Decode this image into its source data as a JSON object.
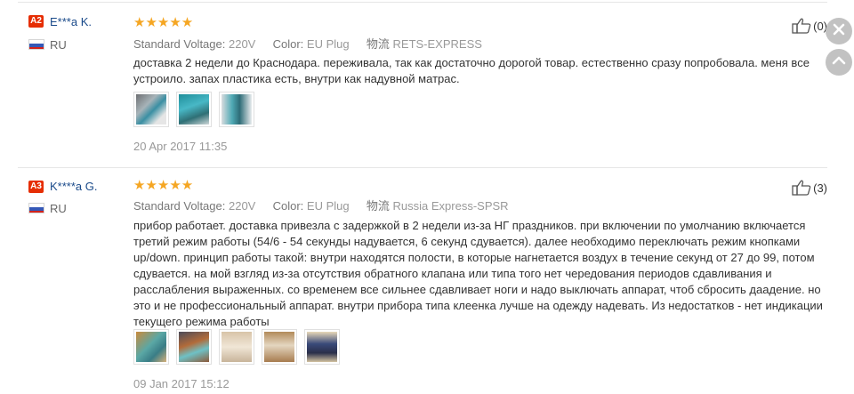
{
  "reviews": [
    {
      "level_badge": "A2",
      "user": "E***a K.",
      "country": "RU",
      "rating_stars": 5,
      "stars_text": "★★★★★",
      "meta": {
        "voltage_label": "Standard Voltage:",
        "voltage_value": "220V",
        "color_label": "Color:",
        "color_value": "EU Plug",
        "ship_label": "物流",
        "ship_value": "RETS-EXPRESS"
      },
      "text": "доставка 2 недели до Краснодара. переживала, так как достаточно дорогой товар. естественно сразу попробовала. меня все устроило. запах пластика есть, внутри как надувной матрас.",
      "date": "20 Apr 2017 11:35",
      "helpful_count": "(0)",
      "photo_count": 3
    },
    {
      "level_badge": "A3",
      "user": "K****a G.",
      "country": "RU",
      "rating_stars": 5,
      "stars_text": "★★★★★",
      "meta": {
        "voltage_label": "Standard Voltage:",
        "voltage_value": "220V",
        "color_label": "Color:",
        "color_value": "EU Plug",
        "ship_label": "物流",
        "ship_value": "Russia Express-SPSR"
      },
      "text": "прибор работает. доставка привезла с задержкой в 2 недели из-за НГ праздников. при включении по умолчанию включается третий режим работы (54/6 - 54 секунды надувается, 6 секунд сдувается). далее необходимо переключать режим кнопками up/down. принцип работы такой: внутри находятся полости, в которые нагнетается воздух в течение секунд от 27 до 99, потом сдувается. на мой взгляд из-за отсутствия обратного клапана или типа того нет чередования периодов сдавливания и расслабления выраженных. со временем все сильнее сдавливает ноги и надо выключать аппарат, чтоб сбросить даадение. но это и не профессиональный аппарат. внутри прибора типа клеенка лучше на одежду надевать. Из недостатков - нет индикации текущего режима работы",
      "date": "09 Jan 2017 15:12",
      "helpful_count": "(3)",
      "photo_count": 5
    }
  ],
  "colors": {
    "badge": "#e62e04",
    "username": "#1a4a8a",
    "stars": "#f5a623",
    "side_buttons": "#c2c2c2"
  },
  "icons": {
    "helpful": "thumbs-up-icon",
    "close": "close-icon",
    "scroll_top": "chevron-up-icon"
  }
}
